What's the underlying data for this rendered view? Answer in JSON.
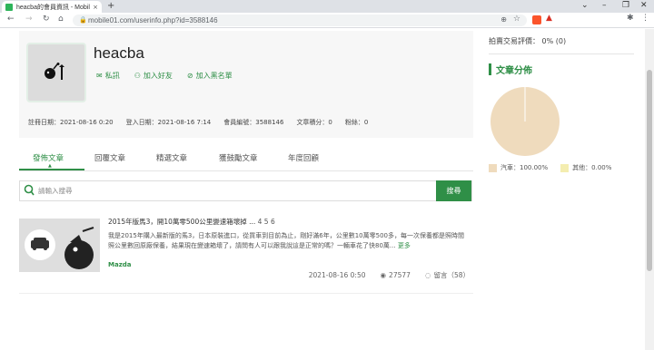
{
  "browser": {
    "tab_title": "heacba的會員資訊 - Mobile01",
    "tab_close": "×",
    "new_tab": "+",
    "url": "mobile01.com/userinfo.php?id=3588146"
  },
  "profile": {
    "username": "heacba",
    "actions": [
      {
        "label": "私訊",
        "icon": "mail-icon"
      },
      {
        "label": "加入好友",
        "icon": "user-add-icon"
      },
      {
        "label": "加入黑名單",
        "icon": "block-icon"
      }
    ],
    "stats": [
      "註冊日期：2021-08-16 0:20",
      "登入日期：2021-08-16 7:14",
      "會員編號：3588146",
      "文章積分：0",
      "粉絲：0"
    ]
  },
  "tabs": [
    "發佈文章",
    "回覆文章",
    "精選文章",
    "獲鼓勵文章",
    "年度回顧"
  ],
  "search": {
    "placeholder": "請輸入搜尋",
    "button": "搜尋"
  },
  "article": {
    "title": "2015年版馬3，開10萬零500公里變速箱壞掉 ...",
    "pages": "4  5  6",
    "body": "我是2015年購入最新版的馬3，日本原裝進口，從買車到目前為止，剛好滿6年，公里數10萬零500多，每一次保養都是照時間照公里數回原廠保養，結果現在變速箱壞了，請問有人可以跟我說這是正常的嗎？一輛車花了快80萬...",
    "more": "更多",
    "tag": "Mazda",
    "date": "2021-08-16 0:50",
    "views": "27577",
    "replies": "留言（58）"
  },
  "sidebar": {
    "auction_rating": "拍賣交易評價： 0% (0)",
    "section_title": "文章分佈"
  },
  "chart_data": {
    "type": "pie",
    "categories": [
      "汽車",
      "其他"
    ],
    "values": [
      100.0,
      0.0
    ],
    "legend": [
      "汽車：100.00%",
      "其他：0.00%"
    ],
    "colors": [
      "#efdbbd",
      "#f4edb0"
    ]
  }
}
